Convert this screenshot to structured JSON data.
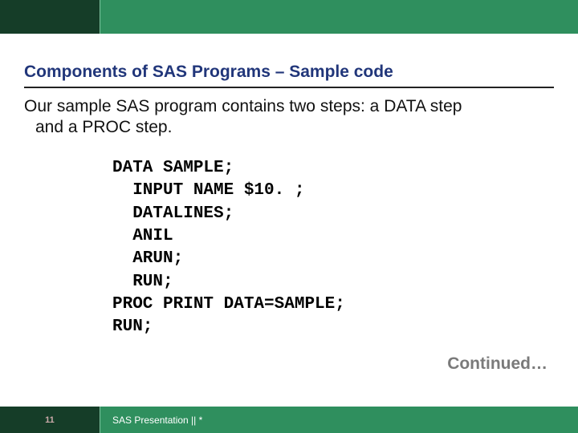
{
  "heading": "Components of SAS Programs – Sample code",
  "body": {
    "line1": "Our sample SAS program contains two steps: a DATA step",
    "line2": "and a PROC step."
  },
  "code": "DATA SAMPLE;\n  INPUT NAME $10. ;\n  DATALINES;\n  ANIL\n  ARUN;\n  RUN;\nPROC PRINT DATA=SAMPLE;\nRUN;",
  "continued": "Continued…",
  "footer": {
    "page": "11",
    "text": "SAS Presentation  ||  *"
  }
}
